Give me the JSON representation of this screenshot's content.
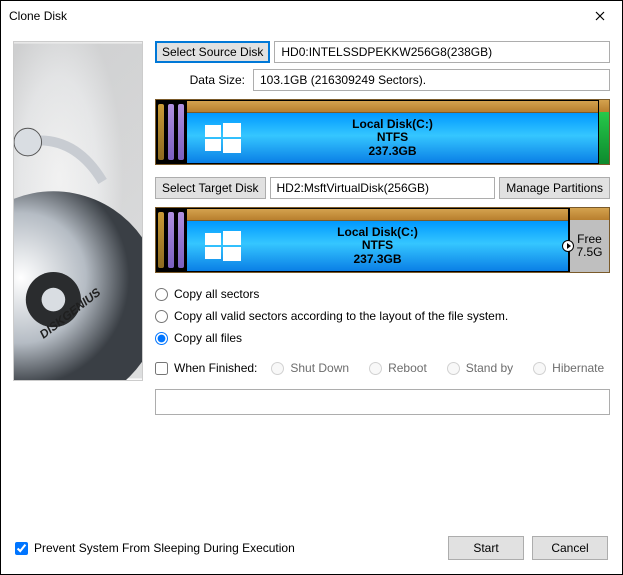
{
  "window": {
    "title": "Clone Disk"
  },
  "source": {
    "button": "Select Source Disk",
    "value": "HD0:INTELSSDPEKKW256G8(238GB)",
    "dataSizeLabel": "Data Size:",
    "dataSize": "103.1GB (216309249 Sectors).",
    "partition": {
      "name": "Local Disk(C:)",
      "fs": "NTFS",
      "size": "237.3GB"
    }
  },
  "target": {
    "button": "Select Target Disk",
    "value": "HD2:MsftVirtualDisk(256GB)",
    "manage": "Manage Partitions",
    "partition": {
      "name": "Local Disk(C:)",
      "fs": "NTFS",
      "size": "237.3GB"
    },
    "free": {
      "label": "Free",
      "size": "7.5G"
    }
  },
  "copyOptions": {
    "allSectors": "Copy all sectors",
    "validSectors": "Copy all valid sectors according to the layout of the file system.",
    "allFiles": "Copy all files",
    "selected": "allFiles"
  },
  "whenFinished": {
    "label": "When Finished:",
    "shutdown": "Shut Down",
    "reboot": "Reboot",
    "standby": "Stand by",
    "hibernate": "Hibernate",
    "checked": false
  },
  "footer": {
    "preventSleep": "Prevent System From Sleeping During Execution",
    "preventSleepChecked": true,
    "start": "Start",
    "cancel": "Cancel"
  }
}
